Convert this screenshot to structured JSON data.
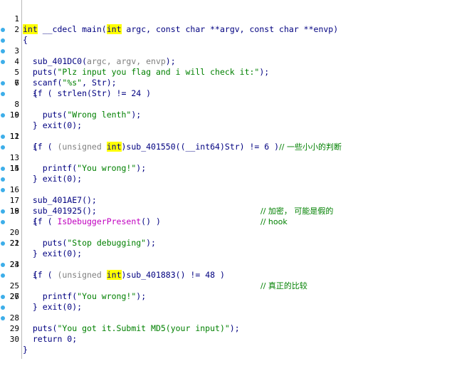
{
  "accent": {
    "dot": "#3daee9",
    "keyword_highlight": "#ffff00"
  },
  "lines": [
    {
      "n": "1",
      "dot": false
    },
    {
      "n": "2",
      "dot": false
    },
    {
      "n": "3",
      "dot": true
    },
    {
      "n": "4",
      "dot": true
    },
    {
      "n": "5",
      "dot": true
    },
    {
      "n": "6",
      "dot": true
    },
    {
      "n": "7",
      "dot": false
    },
    {
      "n": "8",
      "dot": true
    },
    {
      "n": "9",
      "dot": true
    },
    {
      "n": "10",
      "dot": false
    },
    {
      "n": "11",
      "dot": true
    },
    {
      "n": "12",
      "dot": false
    },
    {
      "n": "13",
      "dot": true
    },
    {
      "n": "14",
      "dot": true
    },
    {
      "n": "15",
      "dot": false
    },
    {
      "n": "16",
      "dot": true
    },
    {
      "n": "17",
      "dot": true
    },
    {
      "n": "18",
      "dot": true
    },
    {
      "n": "19",
      "dot": false
    },
    {
      "n": "20",
      "dot": true
    },
    {
      "n": "21",
      "dot": true
    },
    {
      "n": "22",
      "dot": false
    },
    {
      "n": "23",
      "dot": true
    },
    {
      "n": "24",
      "dot": false
    },
    {
      "n": "25",
      "dot": true
    },
    {
      "n": "26",
      "dot": true
    },
    {
      "n": "27",
      "dot": false
    },
    {
      "n": "28",
      "dot": true
    },
    {
      "n": "29",
      "dot": true
    },
    {
      "n": "30",
      "dot": true
    }
  ],
  "code": {
    "l1": {
      "int1": "int",
      "a": " __cdecl main(",
      "int2": "int",
      "b": " argc, const char **argv, const char **envp)"
    },
    "l2": "{",
    "l3": {
      "a": "  sub_401DC0(",
      "args": "argc, argv, envp",
      "b": ");"
    },
    "l4": {
      "a": "  puts(",
      "s": "\"Plz input you flag and i will check it:\"",
      "b": ");"
    },
    "l5": {
      "a": "  scanf(",
      "s": "\"%s\"",
      "b": ", Str);"
    },
    "l6": "  if ( strlen(Str) != 24 )",
    "l7": "  {",
    "l8": {
      "a": "    puts(",
      "s": "\"Wrong lenth\"",
      "b": ");"
    },
    "l9": "    exit(0);",
    "l10": "  }",
    "l11": {
      "a": "  if ( ",
      "u": "(unsigned ",
      "int": "int",
      "b": ")sub_401550((__int64)Str) != 6 )",
      "c": "// 一些小小的判断"
    },
    "l12": "  {",
    "l13": {
      "a": "    printf(",
      "s": "\"You wrong!\"",
      "b": ");"
    },
    "l14": "    exit(0);",
    "l15": "  }",
    "l16": {
      "a": "  sub_401AE7();",
      "c": "// 加密， 可能是假的"
    },
    "l17": {
      "a": "  sub_401925();",
      "c": "// hook"
    },
    "l18": {
      "a": "  if ( ",
      "api": "IsDebuggerPresent",
      "b": "() )"
    },
    "l19": "  {",
    "l20": {
      "a": "    puts(",
      "s": "\"Stop debugging\"",
      "b": ");"
    },
    "l21": "    exit(0);",
    "l22": "  }",
    "l23": {
      "a": "  if ( ",
      "u": "(unsigned ",
      "int": "int",
      "b": ")sub_401883() != 48 )",
      "c": "// 真正的比较"
    },
    "l24": "  {",
    "l25": {
      "a": "    printf(",
      "s": "\"You wrong!\"",
      "b": ");"
    },
    "l26": "    exit(0);",
    "l27": "  }",
    "l28": {
      "a": "  puts(",
      "s": "\"You got it.Submit MD5(your input)\"",
      "b": ");"
    },
    "l29": "  return 0;",
    "l30": "}"
  }
}
